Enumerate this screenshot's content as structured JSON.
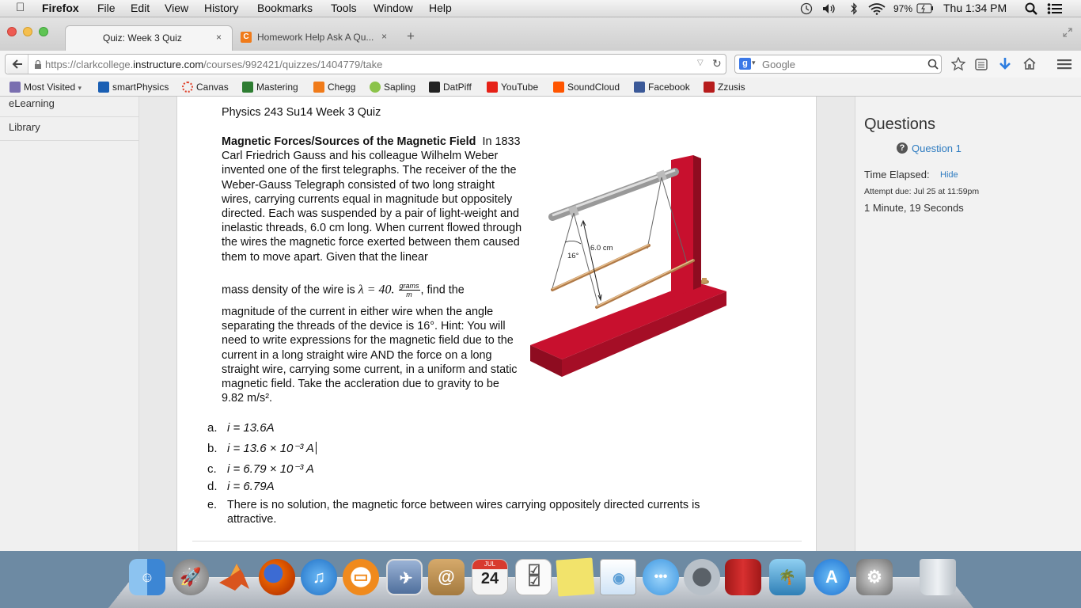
{
  "menubar": {
    "app": "Firefox",
    "items": [
      "File",
      "Edit",
      "View",
      "History",
      "Bookmarks",
      "Tools",
      "Window",
      "Help"
    ],
    "battery": "97%",
    "clock": "Thu 1:34 PM"
  },
  "tabs": [
    {
      "label": "Quiz: Week 3 Quiz",
      "close": "×"
    },
    {
      "label": "Homework Help Ask A Qu...",
      "close": "×"
    }
  ],
  "new_tab": "+",
  "url": {
    "prefix": "https://clarkcollege.",
    "domain": "instructure.com",
    "path": "/courses/992421/quizzes/1404779/take"
  },
  "search": {
    "engine_placeholder": "Google"
  },
  "bookmarks": [
    {
      "label": "Most Visited",
      "color": "#7a6fb0"
    },
    {
      "label": "smartPhysics",
      "color": "#1a5fb4"
    },
    {
      "label": "Canvas",
      "color": "#e0422b"
    },
    {
      "label": "Mastering",
      "color": "#2e7d32"
    },
    {
      "label": "Chegg",
      "color": "#f07b1a"
    },
    {
      "label": "Sapling",
      "color": "#8bc34a"
    },
    {
      "label": "DatPiff",
      "color": "#222222"
    },
    {
      "label": "YouTube",
      "color": "#e62117"
    },
    {
      "label": "SoundCloud",
      "color": "#ff5500"
    },
    {
      "label": "Facebook",
      "color": "#3b5998"
    },
    {
      "label": "Zzusis",
      "color": "#b71c1c"
    }
  ],
  "leftnav": [
    "eLearning",
    "Library"
  ],
  "quiz": {
    "title": "Physics 243 Su14 Week 3 Quiz",
    "heading": "Magnetic Forces/Sources of the Magnetic Field",
    "p1": "In 1833 Carl Friedrich Gauss and his colleague Wilhelm Weber invented one of the first telegraphs.  The receiver of the the Weber-Gauss Telegraph consisted of two long straight wires, carrying currents equal in magnitude but oppositely directed.  Each was suspended by a pair of light-weight and inelastic threads, 6.0 cm long.  When current flowed through the wires the magnetic force exerted  between them caused them to move apart.  Given that the linear",
    "density_lead": "mass density of the wire is",
    "lambda": "λ = 40.",
    "frac_num": "grams",
    "frac_den": "m",
    "density_tail": ", find the",
    "p2": "magnitude of the current in either wire when the angle separating the threads of the device is 16°.  Hint:  You will need to write expressions for the magnetic field due to the current in a long straight wire AND the force on a long straight wire, carrying some current, in a uniform and static magnetic field.  Take the accleration due to gravity to be 9.82 m/s².",
    "figure_length": "6.0 cm",
    "figure_angle": "16°",
    "answers": [
      {
        "letter": "a.",
        "text": "i = 13.6A"
      },
      {
        "letter": "b.",
        "text": "i = 13.6 × 10⁻³ A"
      },
      {
        "letter": "c.",
        "text": "i = 6.79 × 10⁻³ A"
      },
      {
        "letter": "d.",
        "text": "i = 6.79A"
      },
      {
        "letter": "e.",
        "text": "There is no solution, the magnetic force between wires carrying oppositely directed currents is attractive."
      }
    ]
  },
  "sidebar": {
    "title": "Questions",
    "question_link": "Question 1",
    "time_label": "Time Elapsed:",
    "hide_link": "Hide",
    "attempt_due": "Attempt due: Jul 25 at 11:59pm",
    "elapsed": "1 Minute, 19 Seconds"
  },
  "dock": {
    "calendar_month": "JUL",
    "calendar_day": "24",
    "apps": [
      {
        "name": "finder-icon",
        "color": "#4a90d9"
      },
      {
        "name": "launchpad-icon",
        "color": "#8d8d8d"
      },
      {
        "name": "matlab-icon",
        "color": "#d9541e"
      },
      {
        "name": "firefox-icon",
        "color": "#e66000"
      },
      {
        "name": "itunes-icon",
        "color": "#2d7fd3"
      },
      {
        "name": "ibooks-icon",
        "color": "#f08a1d"
      },
      {
        "name": "preview-icon",
        "color": "#6b87b6"
      },
      {
        "name": "contacts-icon",
        "color": "#c49a5b"
      },
      {
        "name": "calendar-icon",
        "color": "#f2f2f2"
      },
      {
        "name": "reminders-icon",
        "color": "#fafafa"
      },
      {
        "name": "stickies-icon",
        "color": "#f2e36b"
      },
      {
        "name": "preview2-icon",
        "color": "#5d9fd6"
      },
      {
        "name": "messages-icon",
        "color": "#5bb5f0"
      },
      {
        "name": "facetime-icon",
        "color": "#9aa3ab"
      },
      {
        "name": "photobooth-icon",
        "color": "#c42b2b"
      },
      {
        "name": "iphoto-icon",
        "color": "#3d8fc7"
      },
      {
        "name": "appstore-icon",
        "color": "#2b8fe0"
      },
      {
        "name": "systemprefs-icon",
        "color": "#8f8f8f"
      },
      {
        "name": "trash-icon",
        "color": "#c9cfd4"
      }
    ]
  }
}
